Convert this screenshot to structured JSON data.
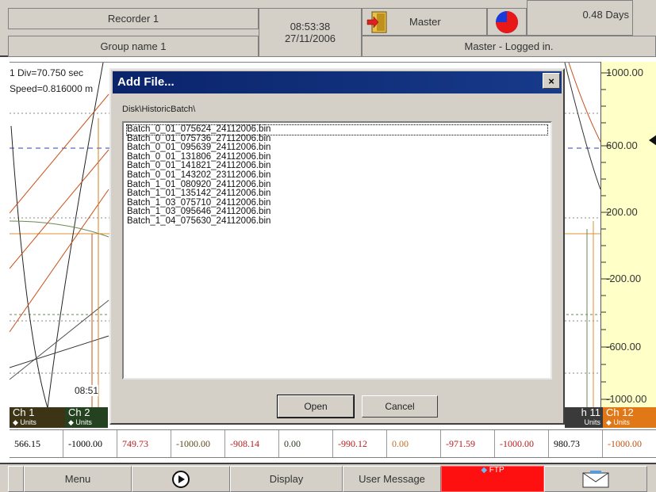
{
  "header": {
    "recorder_name": "Recorder 1",
    "group_name": "Group name 1",
    "time": "08:53:38",
    "date": "27/11/2006",
    "user_level": "Master",
    "login_status": "Master - Logged in.",
    "memory_days": "0.48 Days",
    "pie_fill_percent": 75
  },
  "chart": {
    "div_label": "1 Div=70.750 sec",
    "speed_label": "Speed=0.816000 m",
    "timestamp_label": "08:51",
    "y_scale": [
      "1000.00",
      "600.00",
      "200.00",
      "-200.00",
      "-600.00",
      "-1000.00"
    ]
  },
  "channels": [
    {
      "name": "Ch 1",
      "units": "Units",
      "value": "566.15",
      "color": "#3d3416",
      "value_color": "#000000"
    },
    {
      "name": "Ch 2",
      "units": "Units",
      "value": "-1000.00",
      "color": "#24421f",
      "value_color": "#000000"
    },
    {
      "name": "",
      "units": "",
      "value": "749.73",
      "color": "",
      "value_color": "#b32020"
    },
    {
      "name": "",
      "units": "",
      "value": "-1000.00",
      "color": "",
      "value_color": "#5a4a1a"
    },
    {
      "name": "",
      "units": "",
      "value": "-908.14",
      "color": "",
      "value_color": "#b32020"
    },
    {
      "name": "",
      "units": "",
      "value": "0.00",
      "color": "",
      "value_color": "#2a3a20"
    },
    {
      "name": "",
      "units": "",
      "value": "-990.12",
      "color": "",
      "value_color": "#b32020"
    },
    {
      "name": "",
      "units": "",
      "value": "0.00",
      "color": "",
      "value_color": "#c07020"
    },
    {
      "name": "",
      "units": "",
      "value": "-971.59",
      "color": "",
      "value_color": "#b32020"
    },
    {
      "name": "",
      "units": "",
      "value": "-1000.00",
      "color": "",
      "value_color": "#b32020"
    },
    {
      "name": "h 11",
      "units": "Units",
      "value": "980.73",
      "color": "#3a3a3a",
      "value_color": "#000000"
    },
    {
      "name": "Ch 12",
      "units": "Units",
      "value": "-1000.00",
      "color": "#e07818",
      "value_color": "#c05010"
    }
  ],
  "dialog": {
    "title": "Add File...",
    "close_label": "×",
    "path": "Disk\\HistoricBatch\\",
    "files": [
      "Batch_0_01_075624_24112006.bin",
      "Batch_0_01_075736_27112006.bin",
      "Batch_0_01_095639_24112006.bin",
      "Batch_0_01_131806_24112006.bin",
      "Batch_0_01_141821_24112006.bin",
      "Batch_0_01_143202_23112006.bin",
      "Batch_1_01_080920_24112006.bin",
      "Batch_1_01_135142_24112006.bin",
      "Batch_1_03_075710_24112006.bin",
      "Batch_1_03_095646_24112006.bin",
      "Batch_1_04_075630_24112006.bin"
    ],
    "selected_index": 0,
    "open_label": "Open",
    "cancel_label": "Cancel"
  },
  "toolbar": {
    "menu_label": "Menu",
    "play_icon": "play-icon",
    "display_label": "Display",
    "user_message_label": "User Message",
    "ftp_label": "FTP",
    "mail_icon": "mail-icon",
    "ftp_color": "#ff1010"
  }
}
